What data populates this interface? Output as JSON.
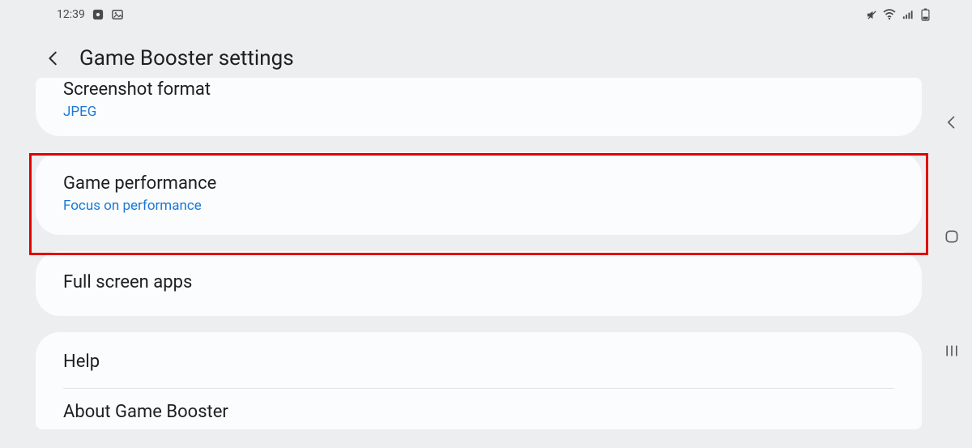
{
  "status_bar": {
    "time": "12:39"
  },
  "header": {
    "title": "Game Booster settings"
  },
  "items": {
    "screenshot_format": {
      "title": "Screenshot format",
      "value": "JPEG"
    },
    "game_performance": {
      "title": "Game performance",
      "value": "Focus on performance"
    },
    "full_screen_apps": {
      "title": "Full screen apps"
    },
    "help": {
      "title": "Help"
    },
    "about": {
      "title": "About Game Booster"
    }
  }
}
